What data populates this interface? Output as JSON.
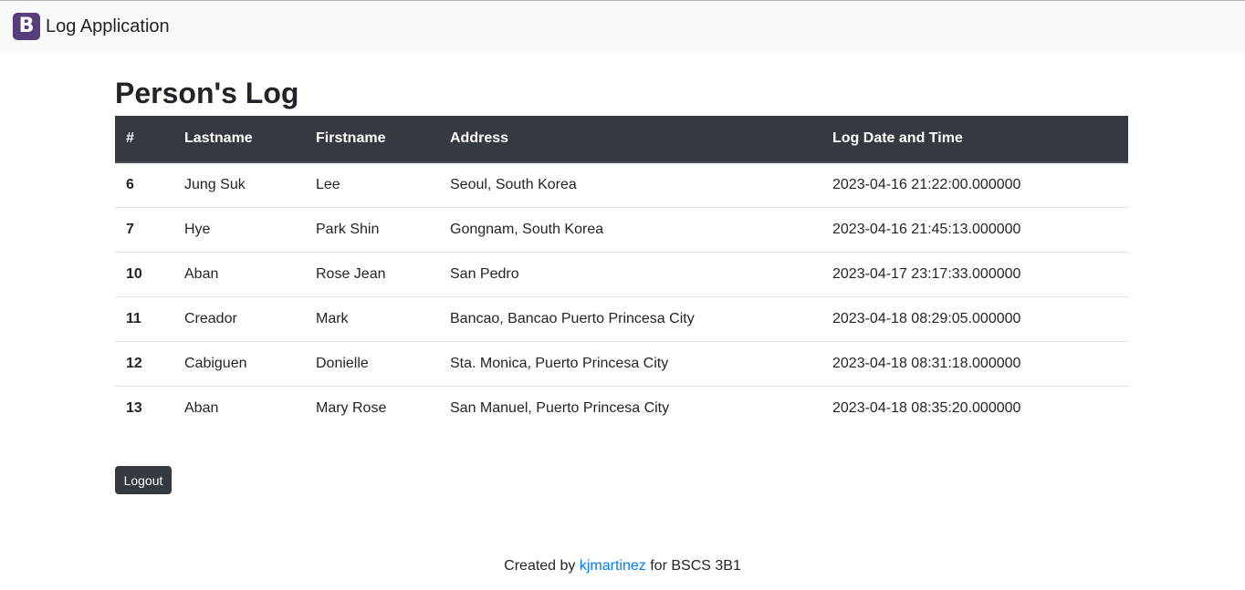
{
  "navbar": {
    "logo_letter": "B",
    "brand": "Log Application"
  },
  "page": {
    "title": "Person's Log"
  },
  "table": {
    "headers": [
      "#",
      "Lastname",
      "Firstname",
      "Address",
      "Log Date and Time"
    ],
    "rows": [
      [
        "6",
        "Jung Suk",
        "Lee",
        "Seoul, South Korea",
        "2023-04-16 21:22:00.000000"
      ],
      [
        "7",
        "Hye",
        "Park Shin",
        "Gongnam, South Korea",
        "2023-04-16 21:45:13.000000"
      ],
      [
        "10",
        "Aban",
        "Rose Jean",
        "San Pedro",
        "2023-04-17 23:17:33.000000"
      ],
      [
        "11",
        "Creador",
        "Mark",
        "Bancao, Bancao Puerto Princesa City",
        "2023-04-18 08:29:05.000000"
      ],
      [
        "12",
        "Cabiguen",
        "Donielle",
        "Sta. Monica, Puerto Princesa City",
        "2023-04-18 08:31:18.000000"
      ],
      [
        "13",
        "Aban",
        "Mary Rose",
        "San Manuel, Puerto Princesa City",
        "2023-04-18 08:35:20.000000"
      ]
    ]
  },
  "actions": {
    "logout_label": "Logout"
  },
  "footer": {
    "prefix": "Created by",
    "author": "kjmartinez",
    "suffix": "for BSCS 3B1"
  },
  "colors": {
    "brand_logo": "#563d7c",
    "table_header": "#343a40",
    "link": "#007bff",
    "navbar_bg": "#f8f9fa"
  }
}
